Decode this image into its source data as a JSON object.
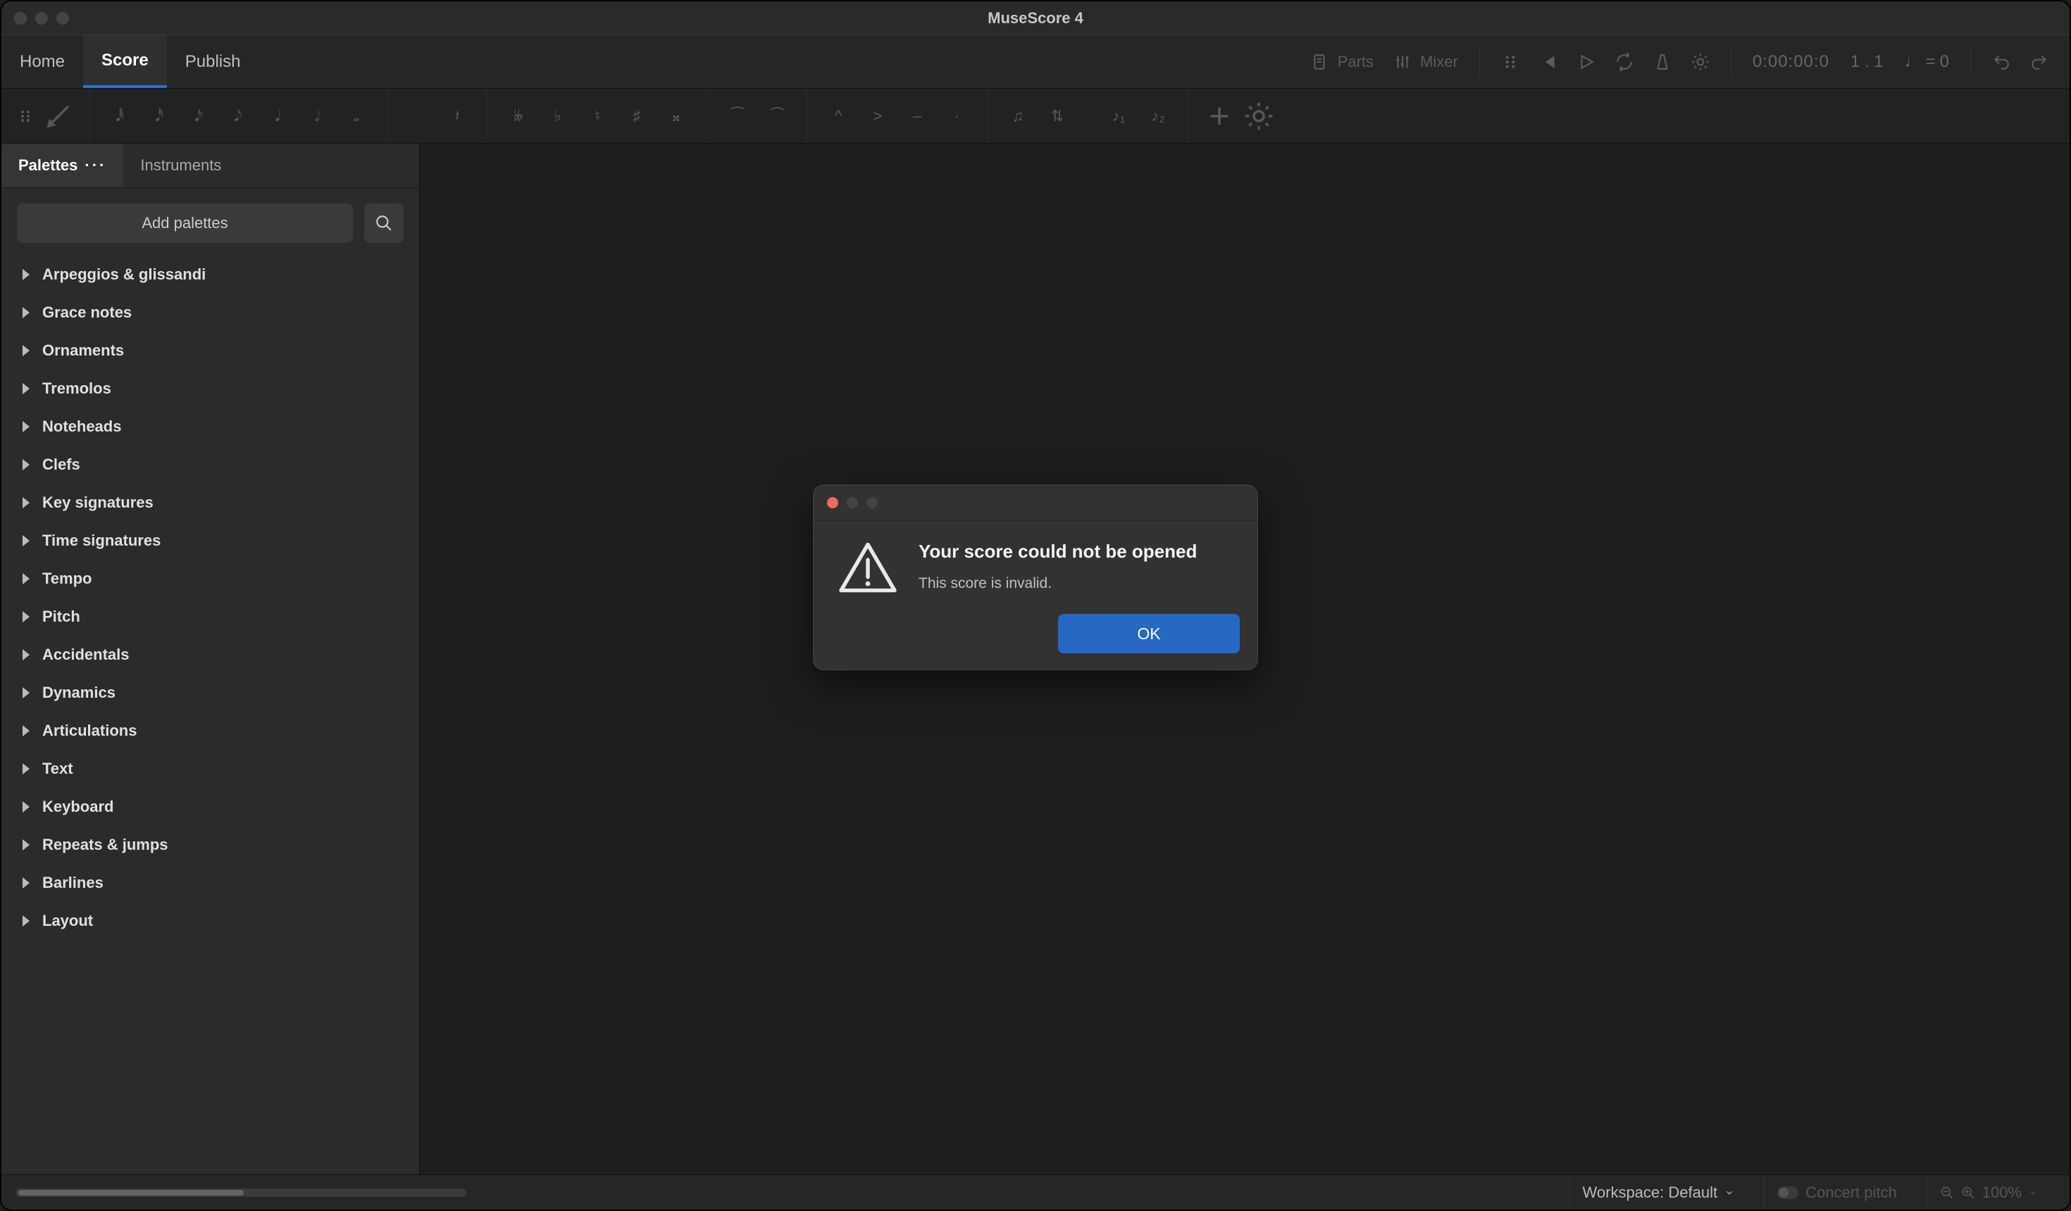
{
  "app_title": "MuseScore 4",
  "tabs": {
    "home": "Home",
    "score": "Score",
    "publish": "Publish"
  },
  "top_controls": {
    "parts": "Parts",
    "mixer": "Mixer",
    "timecode": "0:00:00:0",
    "position": "1 . 1",
    "tempo_prefix": "♩ = ",
    "tempo_value": "0"
  },
  "side": {
    "palettes_tab": "Palettes",
    "instruments_tab": "Instruments",
    "add_button": "Add palettes",
    "items": [
      "Arpeggios & glissandi",
      "Grace notes",
      "Ornaments",
      "Tremolos",
      "Noteheads",
      "Clefs",
      "Key signatures",
      "Time signatures",
      "Tempo",
      "Pitch",
      "Accidentals",
      "Dynamics",
      "Articulations",
      "Text",
      "Keyboard",
      "Repeats & jumps",
      "Barlines",
      "Layout"
    ]
  },
  "status": {
    "workspace": "Workspace: Default",
    "concert_pitch": "Concert pitch",
    "zoom": "100%"
  },
  "dialog": {
    "heading": "Your score could not be opened",
    "message": "This score is invalid.",
    "ok": "OK"
  }
}
